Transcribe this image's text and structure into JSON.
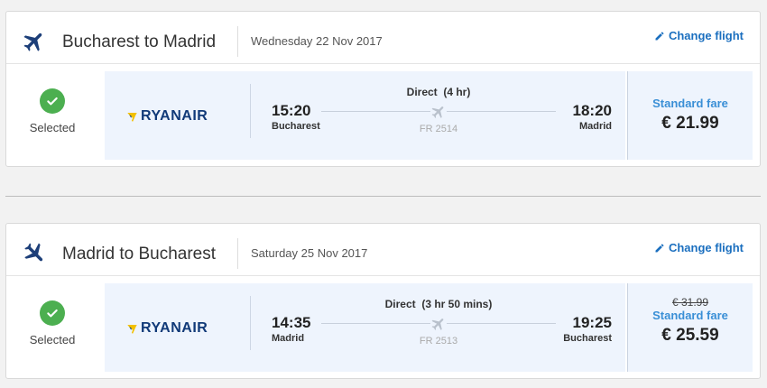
{
  "flights": [
    {
      "route": "Bucharest to Madrid",
      "date": "Wednesday 22 Nov 2017",
      "change_label": "Change flight",
      "selected_label": "Selected",
      "airline": "RYANAIR",
      "dep_time": "15:20",
      "dep_city": "Bucharest",
      "arr_time": "18:20",
      "arr_city": "Madrid",
      "duration": "Direct  (4 hr)",
      "flight_no": "FR 2514",
      "old_price": "",
      "fare_name": "Standard fare",
      "price": "€ 21.99"
    },
    {
      "route": "Madrid to Bucharest",
      "date": "Saturday 25 Nov 2017",
      "change_label": "Change flight",
      "selected_label": "Selected",
      "airline": "RYANAIR",
      "dep_time": "14:35",
      "dep_city": "Madrid",
      "arr_time": "19:25",
      "arr_city": "Bucharest",
      "duration": "Direct  (3 hr 50 mins)",
      "flight_no": "FR 2513",
      "old_price": "€ 31.99",
      "fare_name": "Standard fare",
      "price": "€ 25.59"
    }
  ],
  "colors": {
    "accent": "#1b6fbf",
    "fare": "#3a8fd6",
    "check": "#4caf50",
    "panel": "#eef4fd",
    "brand": "#113a78",
    "brand_mark": "#f2c000"
  },
  "icons": {
    "route": "plane-icon",
    "edit": "pencil-icon",
    "selected": "check-circle-icon",
    "duration": "plane-icon"
  }
}
